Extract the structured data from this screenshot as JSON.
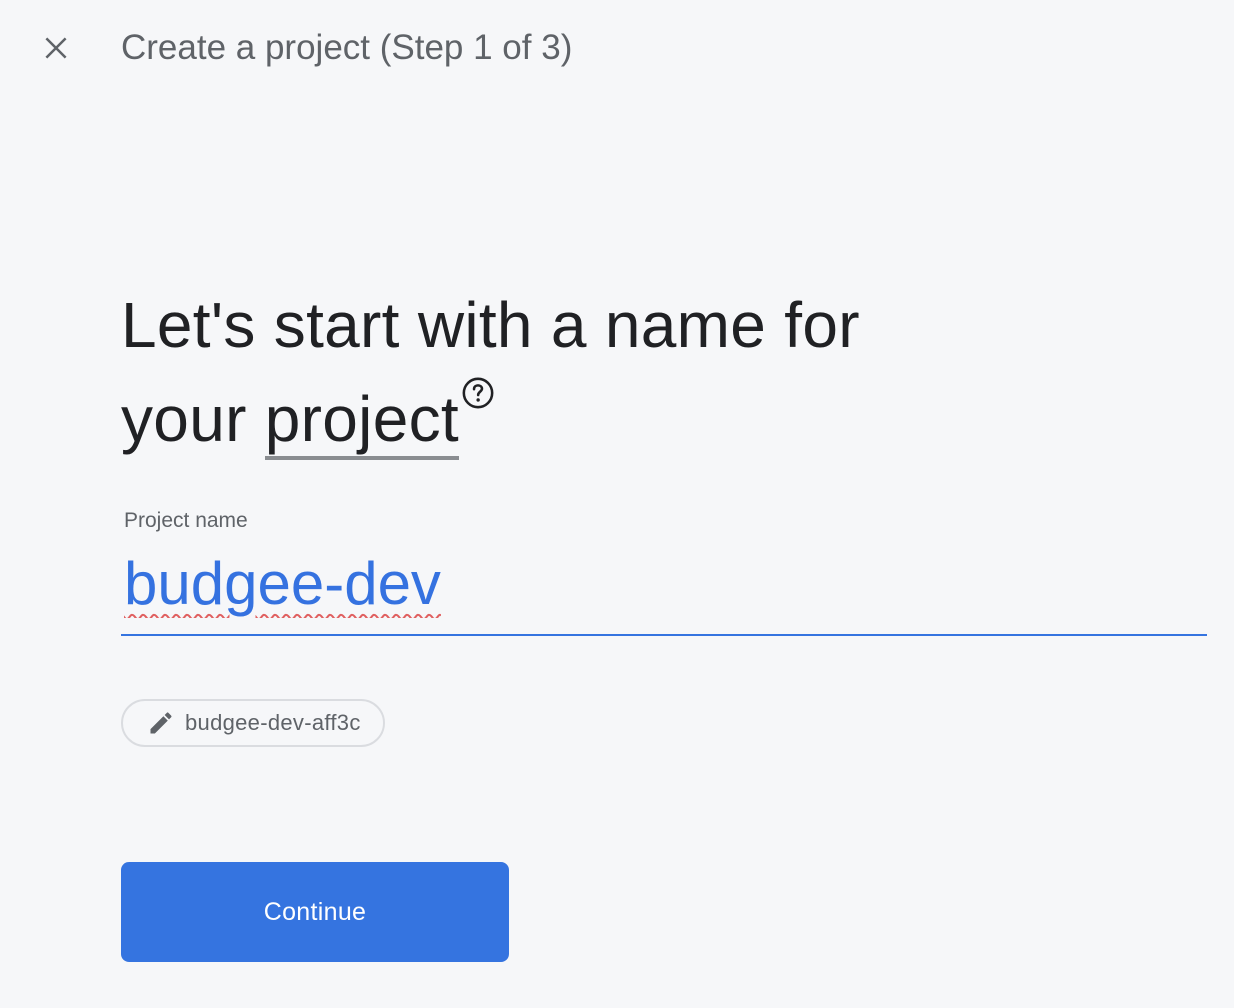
{
  "header": {
    "close_icon": "close-icon",
    "step_title": "Create a project (Step 1 of 3)"
  },
  "heading": {
    "line1": "Let's start with a name for",
    "line2_prefix": "your ",
    "line2_term": "project",
    "help_icon": "help-circle-icon"
  },
  "project_name_field": {
    "label": "Project name",
    "value": "budgee-dev"
  },
  "project_id_chip": {
    "icon": "pencil-icon",
    "value": "budgee-dev-aff3c"
  },
  "continue_button": {
    "label": "Continue"
  },
  "colors": {
    "background": "#f6f7f9",
    "accent": "#3574e0",
    "heading_text": "#202124",
    "secondary_text": "#5f6368",
    "spellcheck_underline": "#e06060"
  }
}
